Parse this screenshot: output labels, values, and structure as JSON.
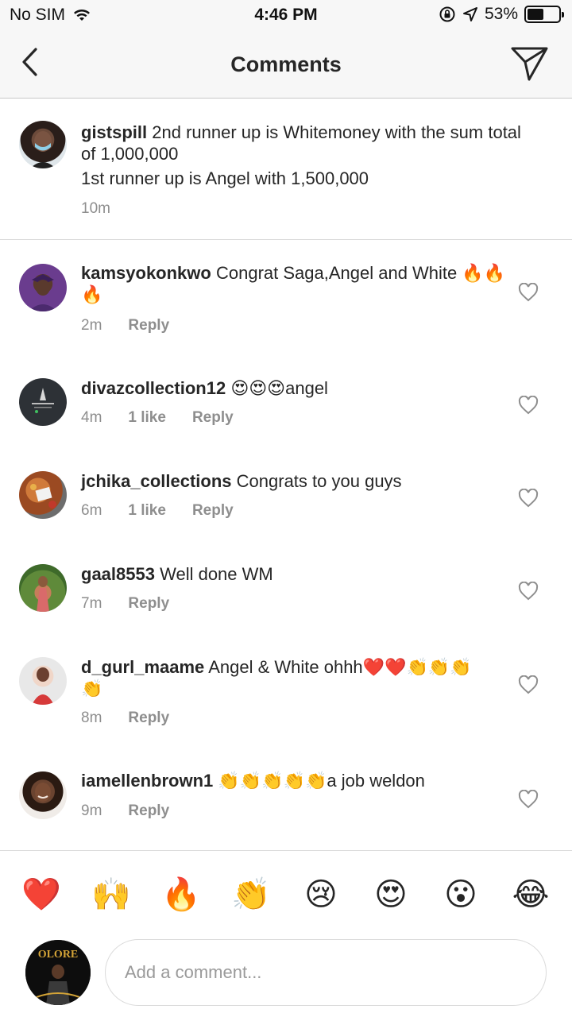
{
  "status_bar": {
    "carrier": "No SIM",
    "time": "4:46 PM",
    "battery": "53%",
    "battery_level": 0.53
  },
  "nav": {
    "title": "Comments",
    "back_icon": "chevron-left-icon",
    "send_icon": "paper-plane-icon"
  },
  "caption": {
    "username": "gistspill",
    "text": "2nd runner up is Whitemoney with the sum total of 1,000,000",
    "text_line2": "1st runner up is Angel with 1,500,000",
    "time": "10m"
  },
  "comments": [
    {
      "username": "kamsyokonkwo",
      "text": "Congrat Saga,Angel and White 🔥🔥🔥",
      "time": "2m",
      "likes": "",
      "reply": "Reply"
    },
    {
      "username": "divazcollection12",
      "text": "😍😍😍angel",
      "time": "4m",
      "likes": "1 like",
      "reply": "Reply"
    },
    {
      "username": "jchika_collections",
      "text": "Congrats to you guys",
      "time": "6m",
      "likes": "1 like",
      "reply": "Reply"
    },
    {
      "username": "gaal8553",
      "text": "Well done WM",
      "time": "7m",
      "likes": "",
      "reply": "Reply"
    },
    {
      "username": "d_gurl_maame",
      "text": "Angel & White ohhh❤️❤️👏👏👏👏",
      "time": "8m",
      "likes": "",
      "reply": "Reply"
    },
    {
      "username": "iamellenbrown1",
      "text": "👏👏👏👏👏a job weldon",
      "time": "9m",
      "likes": "",
      "reply": "Reply"
    }
  ],
  "emoji_bar": [
    "❤️",
    "🙌",
    "🔥",
    "👏",
    "😢",
    "😍",
    "😮",
    "😂"
  ],
  "composer": {
    "placeholder": "Add a comment...",
    "avatar_text": "OLORE"
  },
  "colors": {
    "text": "#262626",
    "meta": "#8e8e8e",
    "divider": "#dbdbdb",
    "bar_bg": "#f7f7f7"
  }
}
